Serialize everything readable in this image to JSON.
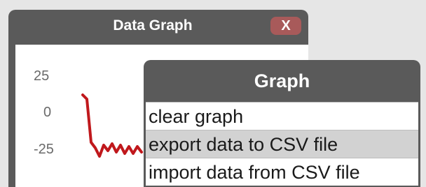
{
  "graph_window": {
    "title": "Data Graph",
    "close_label": "X"
  },
  "chart_data": {
    "type": "line",
    "y_ticks": [
      "25",
      "0",
      "-25"
    ],
    "ylim": [
      -35,
      35
    ],
    "series": [
      {
        "color": "#c0181c",
        "values": [
          18,
          15,
          -16,
          -20,
          -26,
          -18,
          -22,
          -17,
          -23,
          -18,
          -24,
          -19,
          -24,
          -19,
          -23
        ]
      }
    ]
  },
  "menu": {
    "title": "Graph",
    "items": [
      {
        "label": "clear graph",
        "highlighted": false
      },
      {
        "label": "export data to CSV file",
        "highlighted": true
      },
      {
        "label": "import data from CSV file",
        "highlighted": false
      }
    ]
  }
}
